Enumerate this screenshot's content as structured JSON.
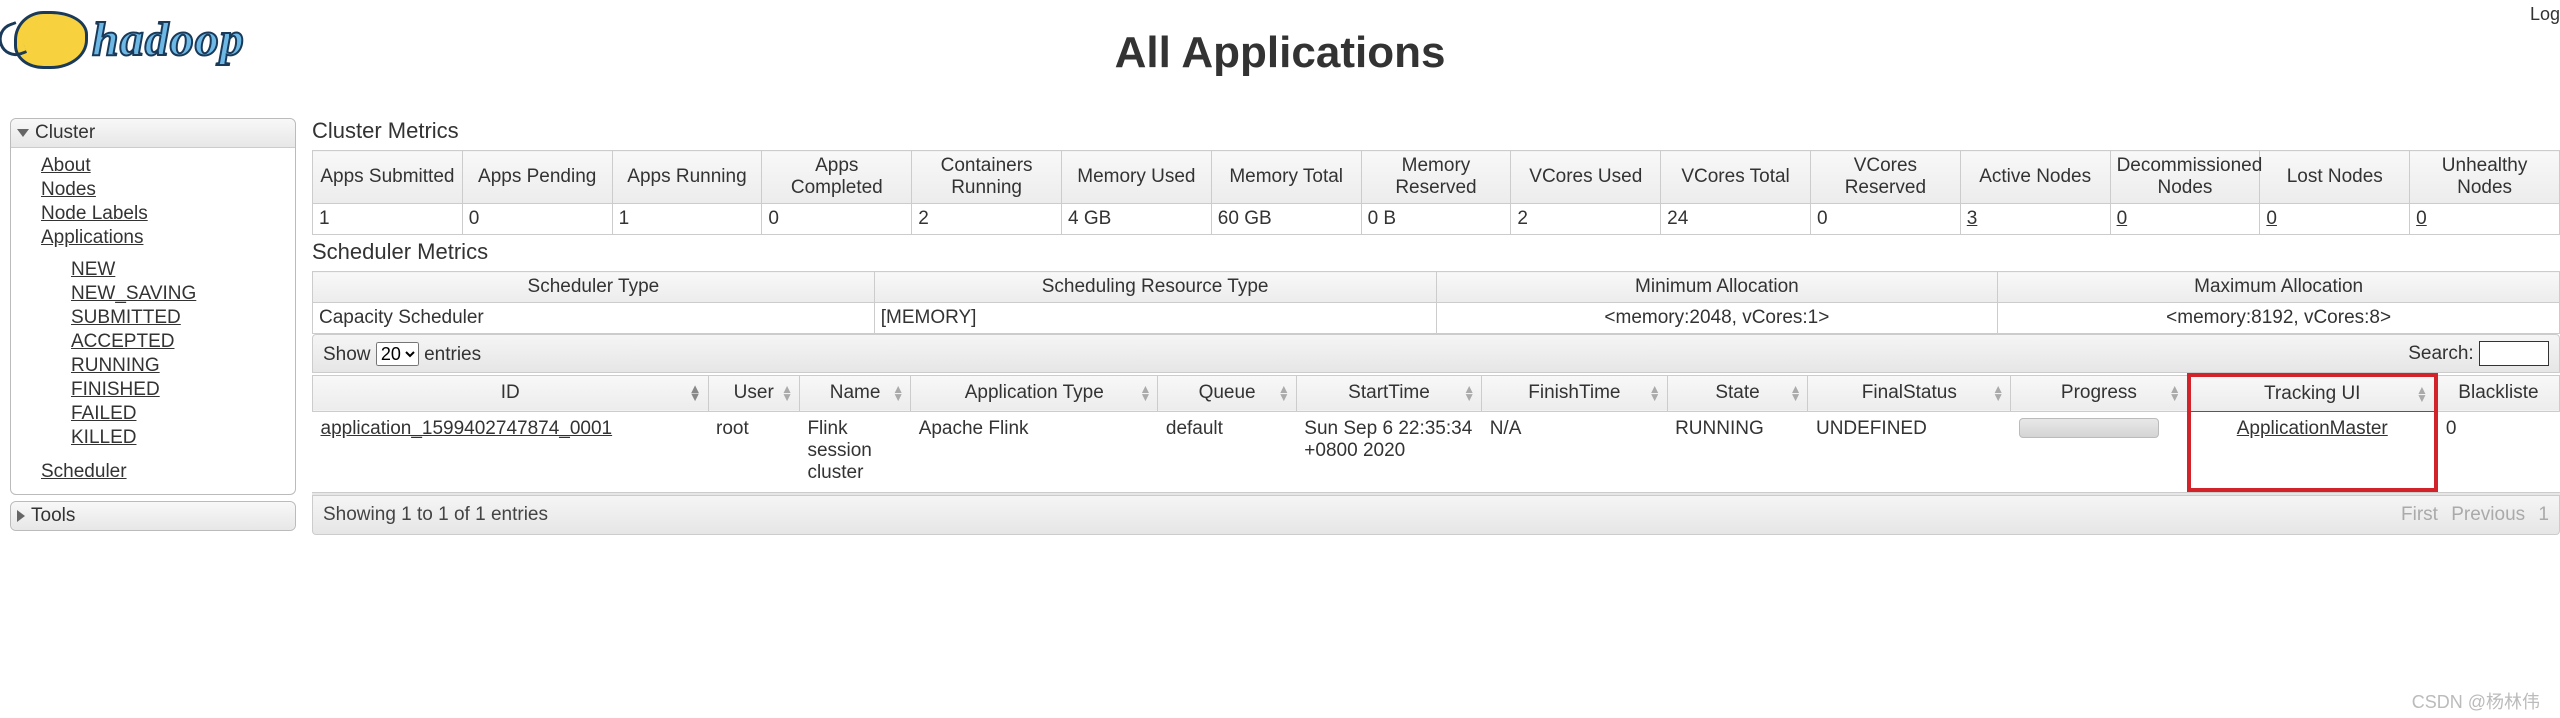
{
  "header": {
    "topRight": "Logge",
    "logoText": "hadoop",
    "title": "All Applications"
  },
  "sidebar": {
    "clusterLabel": "Cluster",
    "toolsLabel": "Tools",
    "links": {
      "about": "About",
      "nodes": "Nodes",
      "nodeLabels": "Node Labels",
      "applications": "Applications",
      "scheduler": "Scheduler"
    },
    "appStates": [
      "NEW",
      "NEW_SAVING",
      "SUBMITTED",
      "ACCEPTED",
      "RUNNING",
      "FINISHED",
      "FAILED",
      "KILLED"
    ]
  },
  "clusterMetrics": {
    "title": "Cluster Metrics",
    "headers": [
      "Apps Submitted",
      "Apps Pending",
      "Apps Running",
      "Apps Completed",
      "Containers Running",
      "Memory Used",
      "Memory Total",
      "Memory Reserved",
      "VCores Used",
      "VCores Total",
      "VCores Reserved",
      "Active Nodes",
      "Decommissioned Nodes",
      "Lost Nodes",
      "Unhealthy Nodes"
    ],
    "values": [
      "1",
      "0",
      "1",
      "0",
      "2",
      "4 GB",
      "60 GB",
      "0 B",
      "2",
      "24",
      "0",
      "3",
      "0",
      "0",
      "0"
    ],
    "linkCols": [
      11,
      12,
      13,
      14
    ]
  },
  "schedulerMetrics": {
    "title": "Scheduler Metrics",
    "headers": [
      "Scheduler Type",
      "Scheduling Resource Type",
      "Minimum Allocation",
      "Maximum Allocation"
    ],
    "values": [
      "Capacity Scheduler",
      "[MEMORY]",
      "<memory:2048, vCores:1>",
      "<memory:8192, vCores:8>"
    ]
  },
  "datatable": {
    "showLabel": "Show",
    "entriesLabel": "entries",
    "pageSize": "20",
    "searchLabel": "Search:",
    "info": "Showing 1 to 1 of 1 entries",
    "pager": {
      "first": "First",
      "prev": "Previous",
      "page": "1"
    },
    "headers": {
      "id": "ID",
      "user": "User",
      "name": "Name",
      "appType": "Application Type",
      "queue": "Queue",
      "start": "StartTime",
      "finish": "FinishTime",
      "state": "State",
      "final": "FinalStatus",
      "progress": "Progress",
      "tracking": "Tracking UI",
      "blacklist": "Blackliste"
    },
    "row": {
      "id": "application_1599402747874_0001",
      "user": "root",
      "name": "Flink session cluster",
      "appType": "Apache Flink",
      "queue": "default",
      "start": "Sun Sep 6 22:35:34 +0800 2020",
      "finish": "N/A",
      "state": "RUNNING",
      "final": "UNDEFINED",
      "tracking": "ApplicationMaster",
      "blacklist": "0"
    }
  },
  "watermark": "CSDN @杨林伟"
}
